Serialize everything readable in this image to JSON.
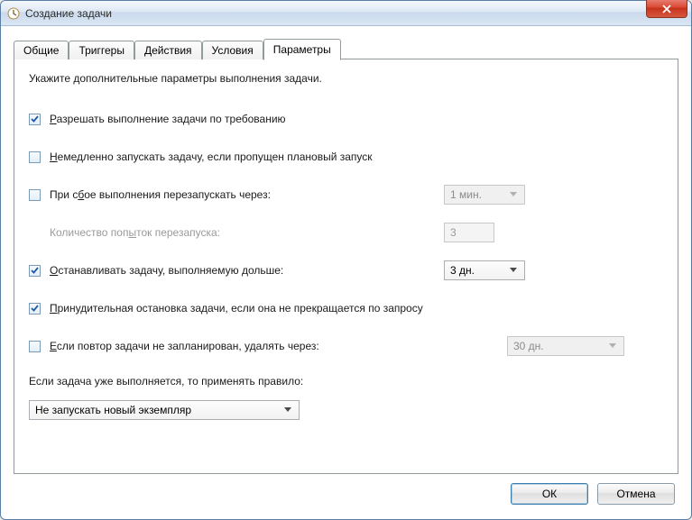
{
  "window": {
    "title": "Создание задачи"
  },
  "tabs": {
    "general": "Общие",
    "triggers": "Триггеры",
    "actions": "Действия",
    "conditions": "Условия",
    "settings": "Параметры"
  },
  "panel": {
    "intro": "Укажите дополнительные параметры выполнения задачи.",
    "allow_on_demand": "Разрешать выполнение задачи по требованию",
    "run_if_missed": "Немедленно запускать задачу, если пропущен плановый запуск",
    "restart_on_fail": "При сбое выполнения перезапускать через:",
    "restart_interval": "1 мин.",
    "restart_count_label": "Количество попыток перезапуска:",
    "restart_count_value": "3",
    "stop_if_longer": "Останавливать задачу, выполняемую дольше:",
    "stop_duration": "3 дн.",
    "force_stop": "Принудительная остановка задачи, если она не прекращается по запросу",
    "delete_if_not_scheduled": "Если повтор задачи не запланирован, удалять через:",
    "delete_after": "30 дн.",
    "rule_label": "Если задача уже выполняется, то применять правило:",
    "rule_value": "Не запускать новый экземпляр"
  },
  "buttons": {
    "ok": "ОК",
    "cancel": "Отмена"
  }
}
